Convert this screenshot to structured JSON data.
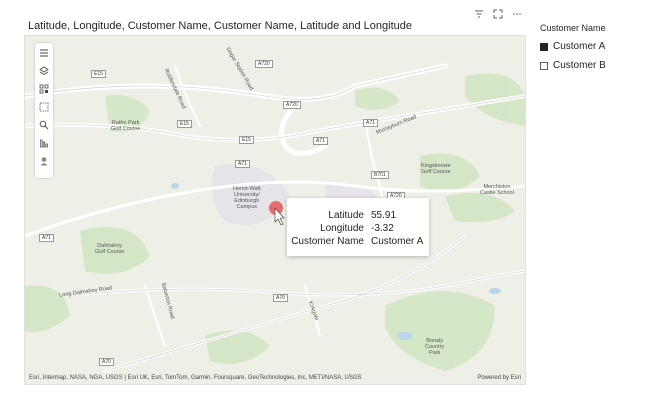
{
  "visual": {
    "title": "Latitude, Longitude, Customer Name, Customer Name, Latitude and Longitude",
    "header_icons": [
      "filter-icon",
      "focus-mode-icon",
      "more-options-icon"
    ]
  },
  "map": {
    "toolbar": [
      "layers-list-icon",
      "layers-icon",
      "qr-select-icon",
      "rectangle-select-icon",
      "search-icon",
      "bar-chart-icon",
      "person-icon"
    ],
    "labels": {
      "heriot_watt": "Heriot-Watt\nUniversity/\nEdinburgh\nCampus",
      "ratho": "Ratho Park\nGolf Course",
      "kingsknowe": "Kingsknowe\nGolf Course",
      "merchiston": "Merchiston\nCastle School",
      "dalmahoy": "Dalmahoy\nGolf Course",
      "bonaly": "Bonaly\nCountry\nPark",
      "long_dalmahoy": "Long Dalmahoy Road",
      "murrayburn": "Murrayburn Road",
      "riddlesdale": "Riddlesdale Road",
      "gogar_station": "Gogar Station Road",
      "baberton": "Baberton Road",
      "kirkgate": "Kirkgate"
    },
    "shields": {
      "a720_top": "A720",
      "e15_left": "E15",
      "a720_mid": "A720",
      "e15_mid": "E15",
      "e15_mid2": "E15",
      "a71_r": "A71",
      "a71_r2": "A71",
      "a71_c": "A71",
      "b701": "B701",
      "a720_low": "A720",
      "a71_left": "A71",
      "a70_mid": "A70",
      "a70_bot": "A70"
    },
    "tooltip": {
      "rows": [
        {
          "label": "Latitude",
          "value": "55.91"
        },
        {
          "label": "Longitude",
          "value": "-3.32"
        },
        {
          "label": "Customer Name",
          "value": "Customer A"
        }
      ]
    },
    "attribution": "Esri, Intermap, NASA, NGA, USGS | Esri UK, Esri, TomTom, Garmin, Foursquare, GeoTechnologies, Inc, METI/NASA, USGS",
    "powered_by": "Powered by Esri",
    "marker_color": "#e66c6c"
  },
  "legend": {
    "title": "Customer Name",
    "items": [
      {
        "label": "Customer A",
        "checked": true
      },
      {
        "label": "Customer B",
        "checked": false
      }
    ]
  }
}
